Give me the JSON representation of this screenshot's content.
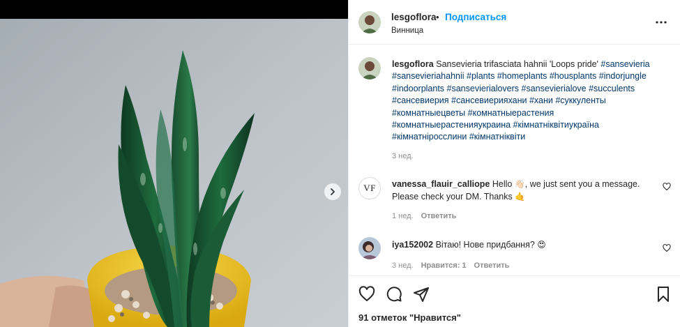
{
  "post": {
    "username": "lesgoflora",
    "dot": "•",
    "follow_label": "Подписаться",
    "location": "Винница",
    "caption_title": "Sansevieria trifasciata hahnii 'Loops pride'",
    "hashtags": "#sansevieria #sansevieriahahnii #plants #homeplants #housplants #indorjungle #indoorplants #sansevierialovers #sansevierialove #succulents #сансевиерия #сансевиерияхани #хани #суккуленты #комнатныецветы #комнатныерастения #комнатныерастенияукраина #кімнатніквітиукраїна #кімнатніросслини #кімнатніквіти",
    "caption_time": "3 нед.",
    "likes": "91 отметок \"Нравится\""
  },
  "comments": [
    {
      "username": "vanessa_flauir_calliope",
      "avatar_text": "VF",
      "text_before": "Hello",
      "emoji1": "👋🏻",
      "text_after": ", we just sent you a message. Please check your DM. Thanks",
      "emoji2": "🤙",
      "time": "1 нед.",
      "reply_label": "Ответить"
    },
    {
      "username": "iya152002",
      "text": "Вітаю! Нове придбання?",
      "emoji": "😍",
      "time": "3 нед.",
      "likes_label": "Нравится: 1",
      "reply_label": "Ответить"
    }
  ],
  "icons": {
    "more": "more-options-icon",
    "next": "chevron-right-icon",
    "like": "heart-icon",
    "comment": "comment-icon",
    "share": "paper-plane-icon",
    "save": "bookmark-icon"
  },
  "colors": {
    "link": "#0095f6",
    "hashtag": "#00376b",
    "muted": "#8e8e8e"
  }
}
